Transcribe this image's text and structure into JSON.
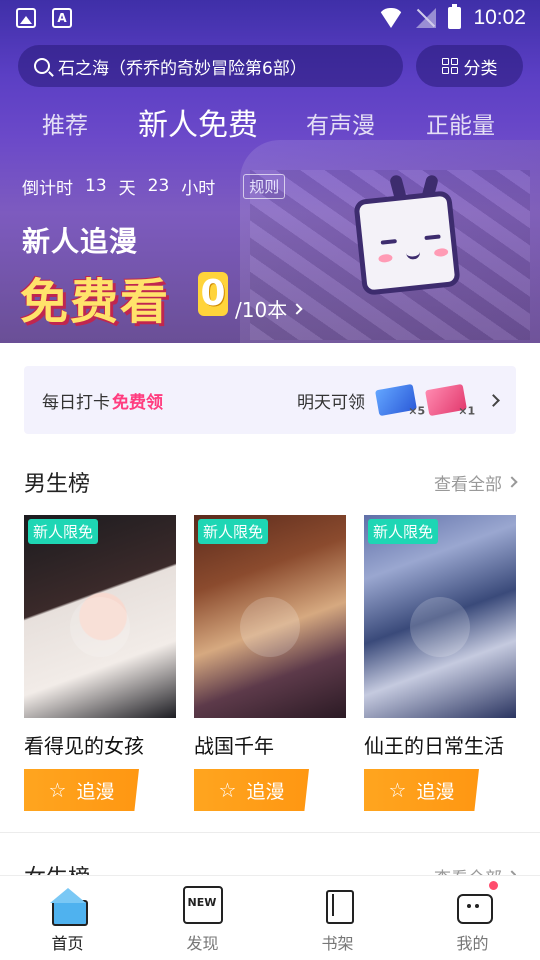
{
  "status_bar": {
    "time": "10:02"
  },
  "search": {
    "placeholder": "石之海（乔乔的奇妙冒险第6部）"
  },
  "category_button": {
    "label": "分类"
  },
  "tabs": [
    {
      "label": "推荐",
      "active": false
    },
    {
      "label": "新人免费",
      "active": true
    },
    {
      "label": "有声漫",
      "active": false
    },
    {
      "label": "正能量",
      "active": false
    }
  ],
  "banner": {
    "countdown_label": "倒计时",
    "days": "13",
    "days_unit": "天",
    "hours": "23",
    "hours_unit": "小时",
    "rules_label": "规则",
    "title": "新人追漫",
    "headline": "免费看",
    "count": "0",
    "total": "/10本"
  },
  "checkin": {
    "label": "每日打卡",
    "highlight": "免费领",
    "tomorrow_label": "明天可领",
    "ticket1_qty": "×5",
    "ticket2_qty": "×1"
  },
  "boys_section": {
    "title": "男生榜",
    "see_all": "查看全部",
    "items": [
      {
        "badge": "新人限免",
        "title": "看得见的女孩",
        "button": "追漫"
      },
      {
        "badge": "新人限免",
        "title": "战国千年",
        "button": "追漫"
      },
      {
        "badge": "新人限免",
        "title": "仙王的日常生活",
        "button": "追漫"
      }
    ]
  },
  "girls_section": {
    "title": "女生榜",
    "see_all": "查看全部"
  },
  "bottom_nav": [
    {
      "label": "首页",
      "active": true
    },
    {
      "label": "发现",
      "active": false
    },
    {
      "label": "书架",
      "active": false
    },
    {
      "label": "我的",
      "active": false
    }
  ],
  "colors": {
    "accent_orange": "#ff9f1a",
    "badge_teal": "#1ed6b4",
    "highlight_pink": "#ff3d7f",
    "hero_purple": "#5b3fc4"
  }
}
